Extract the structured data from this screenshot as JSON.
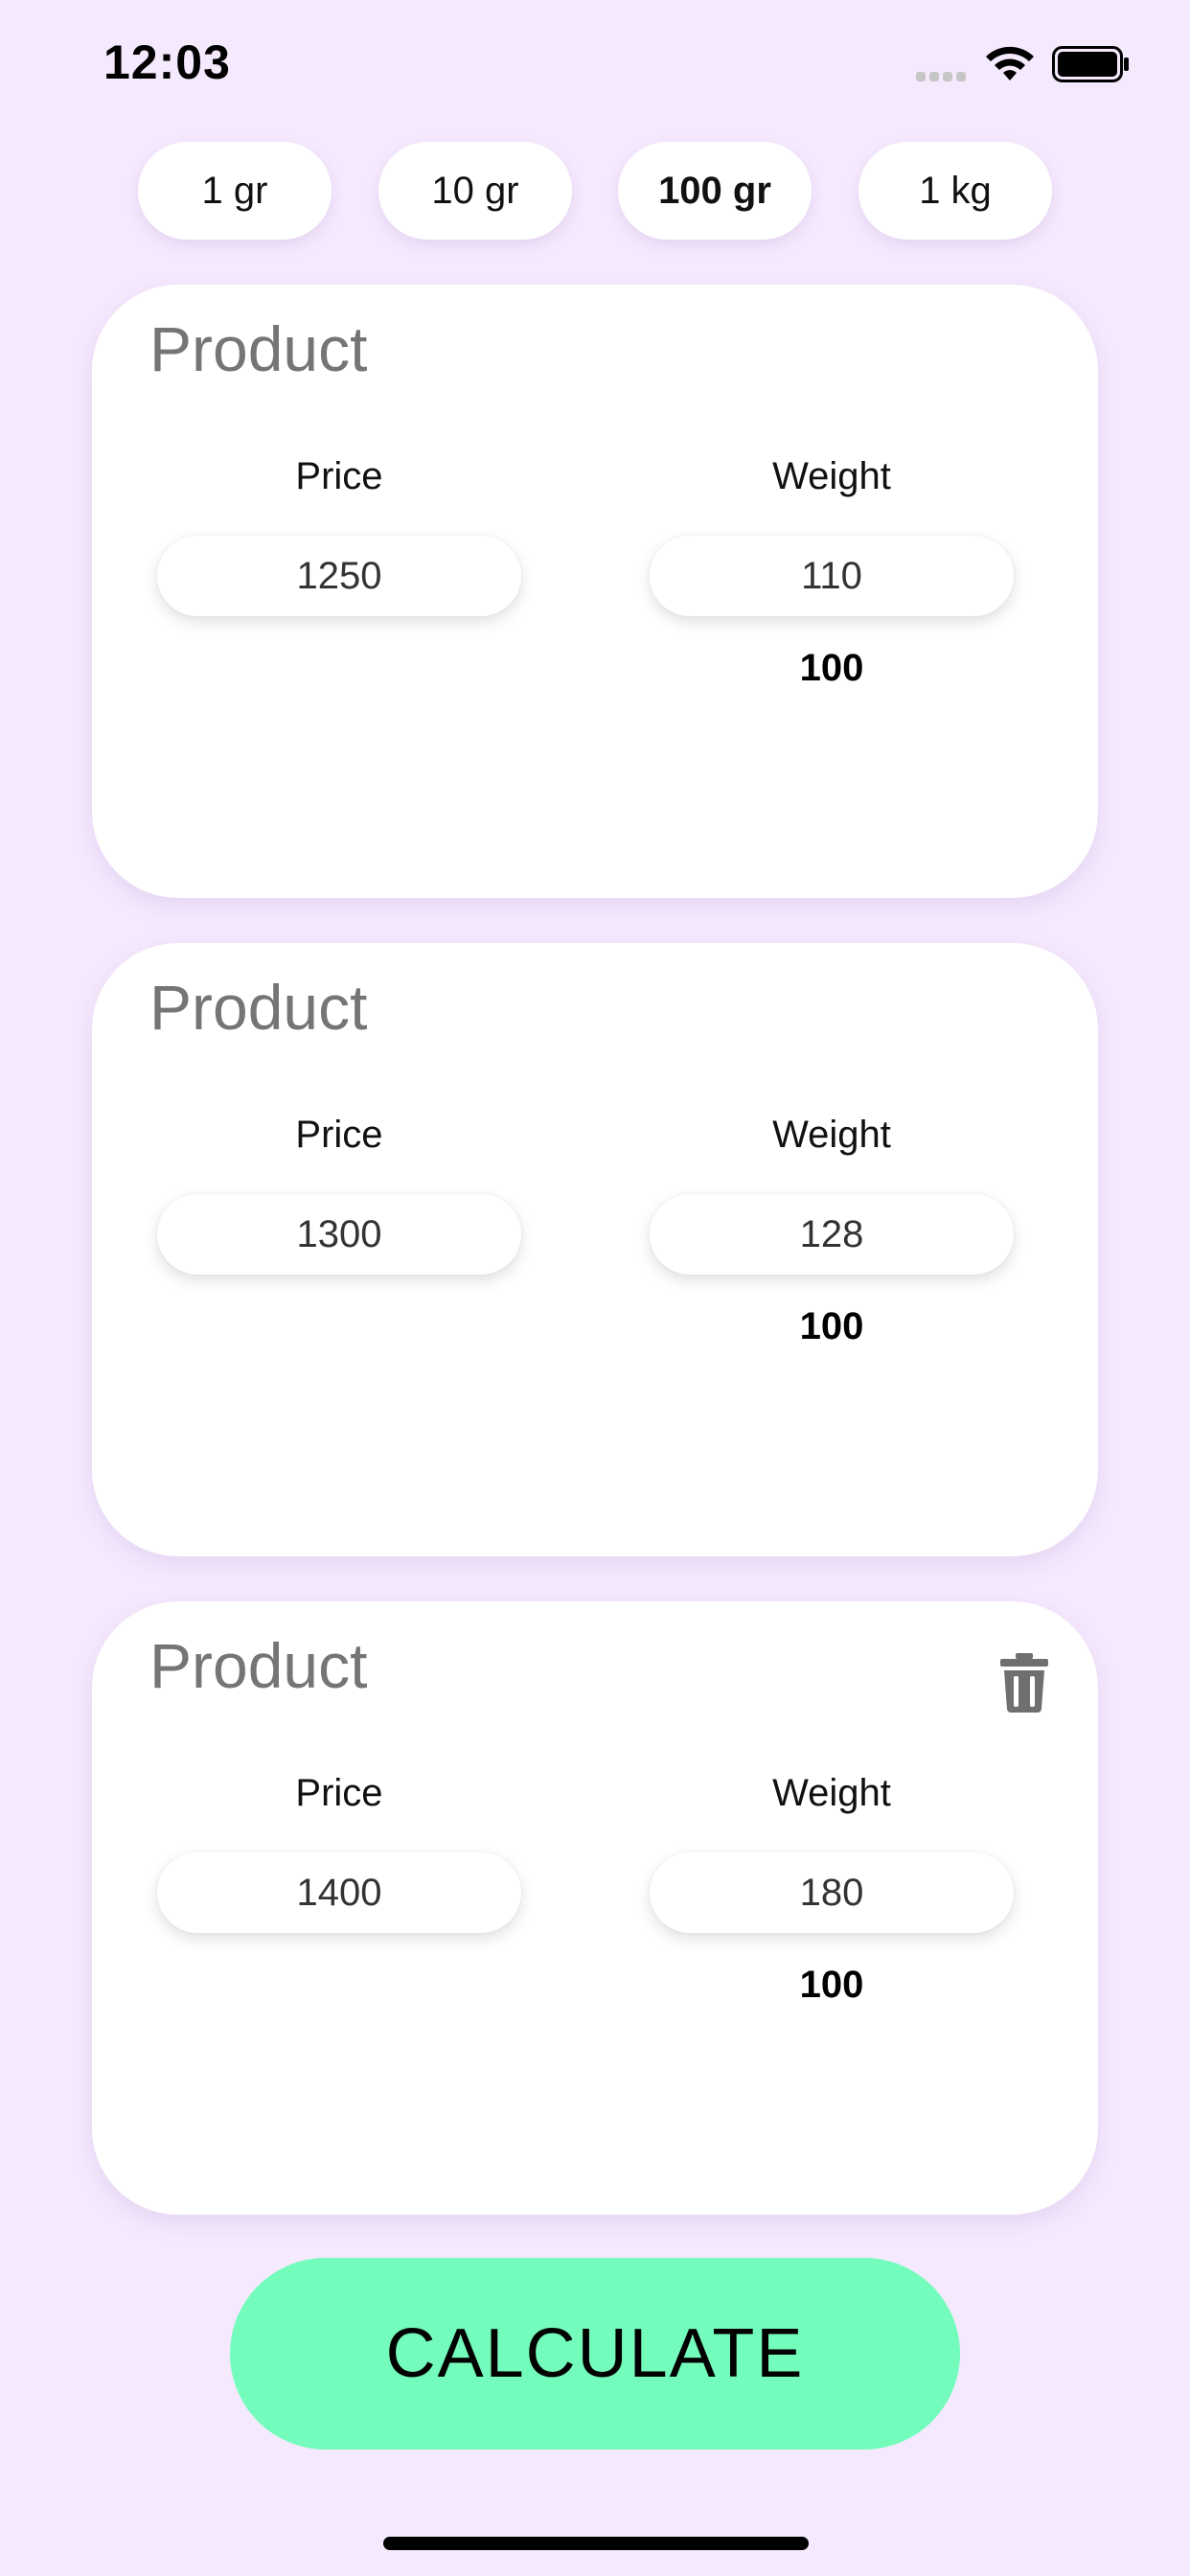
{
  "status_bar": {
    "time": "12:03"
  },
  "units": [
    {
      "label": "1 gr",
      "active": false
    },
    {
      "label": "10 gr",
      "active": false
    },
    {
      "label": "100 gr",
      "active": true
    },
    {
      "label": "1 kg",
      "active": false
    }
  ],
  "products": [
    {
      "name_placeholder": "Product",
      "price_label": "Price",
      "weight_label": "Weight",
      "price": "1250",
      "weight": "110",
      "base": "100",
      "deletable": false
    },
    {
      "name_placeholder": "Product",
      "price_label": "Price",
      "weight_label": "Weight",
      "price": "1300",
      "weight": "128",
      "base": "100",
      "deletable": false
    },
    {
      "name_placeholder": "Product",
      "price_label": "Price",
      "weight_label": "Weight",
      "price": "1400",
      "weight": "180",
      "base": "100",
      "deletable": true
    }
  ],
  "calculate_label": "CALCULATE",
  "colors": {
    "background": "#f5e9fd",
    "accent": "#74fcbd",
    "card": "#ffffff",
    "placeholder": "#c9c9c9"
  },
  "icons": {
    "delete": "trash-icon",
    "wifi": "wifi-icon",
    "battery": "battery-icon",
    "signal": "signal-icon"
  }
}
